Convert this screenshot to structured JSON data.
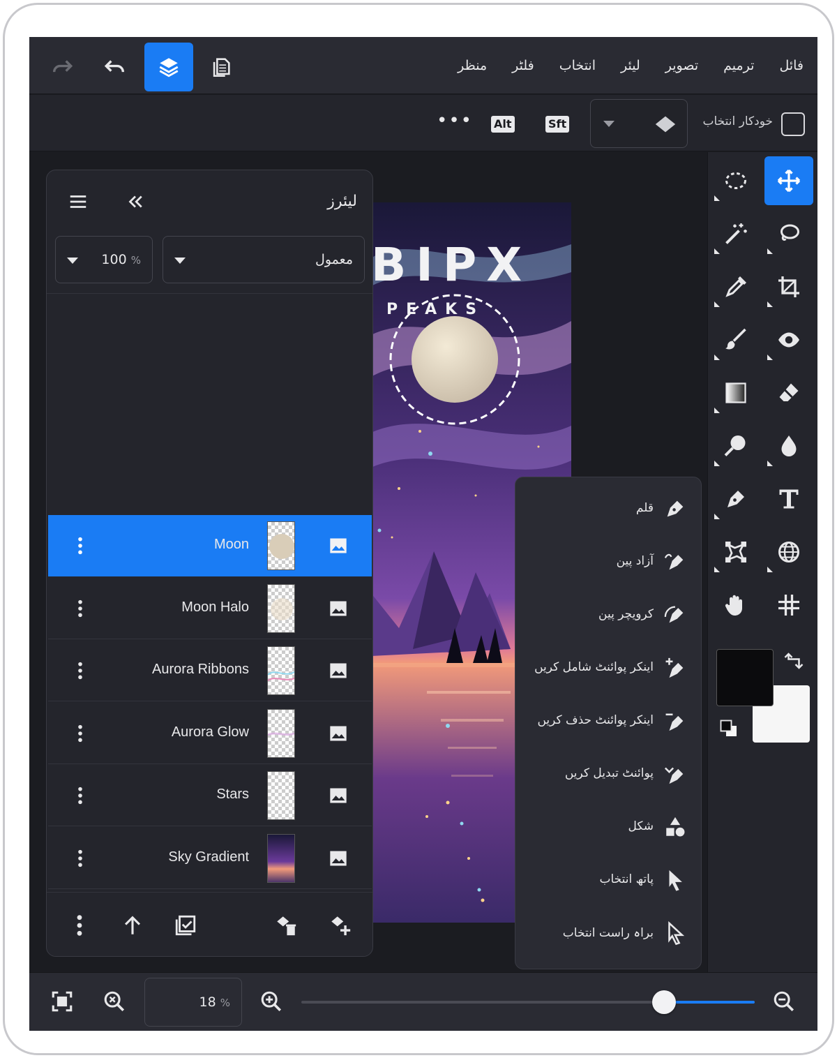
{
  "menu": [
    "فائل",
    "ترمیم",
    "تصویر",
    "لیئر",
    "انتخاب",
    "فلٹر",
    "منظر"
  ],
  "options": {
    "auto_select_label": "خودکار انتخاب",
    "shift_key": "Sft",
    "alt_key": "Alt",
    "more_label": "•••"
  },
  "layers_panel": {
    "title": "لیئرز",
    "blend_mode": "معمول",
    "opacity_value": "100",
    "opacity_unit": "%",
    "items": [
      {
        "name": "Moon",
        "selected": true
      },
      {
        "name": "Moon Halo",
        "selected": false
      },
      {
        "name": "Aurora Ribbons",
        "selected": false
      },
      {
        "name": "Aurora Glow",
        "selected": false
      },
      {
        "name": "Stars",
        "selected": false
      },
      {
        "name": "Sky Gradient",
        "selected": false
      }
    ]
  },
  "artwork": {
    "title_text": "BIPX",
    "subtitle_text": "PEAKS"
  },
  "pen_tools": [
    "قلم",
    "آزاد پین",
    "کرویچر پین",
    "اینکر پوائنٹ شامل کریں",
    "اینکر پوائنٹ حذف کریں",
    "پوائنٹ تبدیل کریں",
    "شکل",
    "پاتھ انتخاب",
    "براہ راست انتخاب"
  ],
  "zoom": {
    "value": "18",
    "unit": "%",
    "slider_level": 0.8
  },
  "colors": {
    "accent": "#1a7cf4",
    "foreground": "#0b0b0d",
    "background": "#f6f6f6"
  }
}
